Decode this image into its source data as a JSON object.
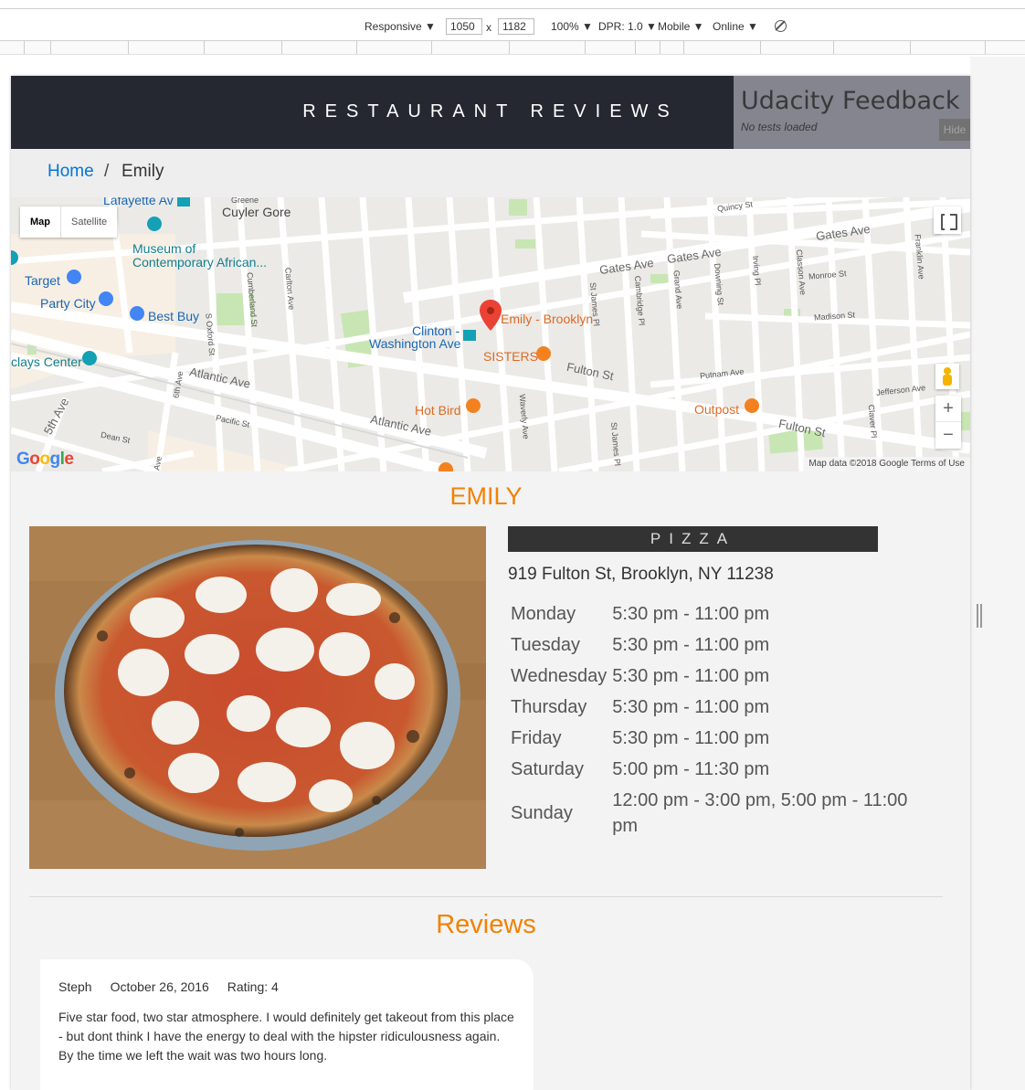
{
  "devtools": {
    "device": "Responsive ▼",
    "width": "1050",
    "times": "x",
    "height": "1182",
    "zoom": "100% ▼",
    "dpr": "DPR: 1.0 ▼",
    "mode": "Mobile ▼",
    "network": "Online ▼",
    "rotate_icon": "rotate-icon"
  },
  "header": {
    "title": "Restaurant Reviews"
  },
  "feedback": {
    "title": "Udacity Feedback",
    "status": "No tests loaded",
    "hide_label": "Hide"
  },
  "breadcrumb": {
    "home": "Home",
    "separator": "/",
    "current": "Emily"
  },
  "map": {
    "type_map": "Map",
    "type_satellite": "Satellite",
    "zoom_in": "+",
    "zoom_out": "−",
    "attribution": "Map data ©2018 Google   Terms of Use",
    "logo": [
      "G",
      "o",
      "o",
      "g",
      "l",
      "e"
    ],
    "marker_label": "Emily - Brooklyn",
    "labels": {
      "lafayette": "Lafayette Av",
      "cuyler_gore": "Cuyler Gore",
      "greene": "Greene",
      "museum": "Museum of",
      "museum2": "Contemporary African...",
      "target": "Target",
      "party_city": "Party City",
      "best_buy": "Best Buy",
      "barclays": "clays Center",
      "atlantic_ave_1": "Atlantic Ave",
      "atlantic_ave_2": "Atlantic Ave",
      "fifth_ave": "5th Ave",
      "sixth_ave": "6th Ave",
      "pacific_st": "Pacific St",
      "dean_st": "Dean St",
      "clinton": "Clinton -",
      "clinton2": "Washington Ave",
      "sisters": "SISTERS",
      "hot_bird": "Hot Bird",
      "outpost": "Outpost",
      "fulton_st_1": "Fulton St",
      "fulton_st_2": "Fulton St",
      "gates_ave_1": "Gates Ave",
      "gates_ave_2": "Gates Ave",
      "gates_ave_3": "Gates Ave",
      "quincy_st": "Quincy St",
      "monroe_st": "Monroe St",
      "madison_st": "Madison St",
      "putnam_ave": "Putnam Ave",
      "jefferson_ave": "Jefferson Ave",
      "carlton_ave": "Carlton Ave",
      "cumberland_st": "Cumberland St",
      "s_oxford_st": "S Oxford St",
      "st_james_pl_1": "St James Pl",
      "st_james_pl_2": "St James Pl",
      "cambridge_pl": "Cambridge Pl",
      "grand_ave": "Grand Ave",
      "downing_st": "Downing St",
      "irving_pl": "Irving Pl",
      "classon_ave": "Classon Ave",
      "franklin_ave": "Franklin Ave",
      "claver_pl": "Claver Pl",
      "waverly_ave": "Waverly Ave",
      "ave": "Ave"
    }
  },
  "restaurant": {
    "name": "Emily",
    "cuisine": "Pizza",
    "address": "919 Fulton St, Brooklyn, NY 11238",
    "hours": [
      {
        "day": "Monday",
        "time": "5:30 pm - 11:00 pm"
      },
      {
        "day": "Tuesday",
        "time": "5:30 pm - 11:00 pm"
      },
      {
        "day": "Wednesday",
        "time": "5:30 pm - 11:00 pm"
      },
      {
        "day": "Thursday",
        "time": "5:30 pm - 11:00 pm"
      },
      {
        "day": "Friday",
        "time": "5:30 pm - 11:00 pm"
      },
      {
        "day": "Saturday",
        "time": "5:00 pm - 11:30 pm"
      },
      {
        "day": "Sunday",
        "time": "12:00 pm - 3:00 pm, 5:00 pm - 11:00 pm"
      }
    ]
  },
  "reviews": {
    "title": "Reviews",
    "items": [
      {
        "name": "Steph",
        "date": "October 26, 2016",
        "rating": "Rating: 4",
        "comments": "Five star food, two star atmosphere. I would definitely get takeout from this place - but dont think I have the energy to deal with the hipster ridiculousness again. By the time we left the wait was two hours long."
      }
    ]
  },
  "colors": {
    "header_bg": "#252831",
    "accent": "#f18200",
    "link": "#0275d8",
    "page_bg": "#f3f3f3"
  }
}
